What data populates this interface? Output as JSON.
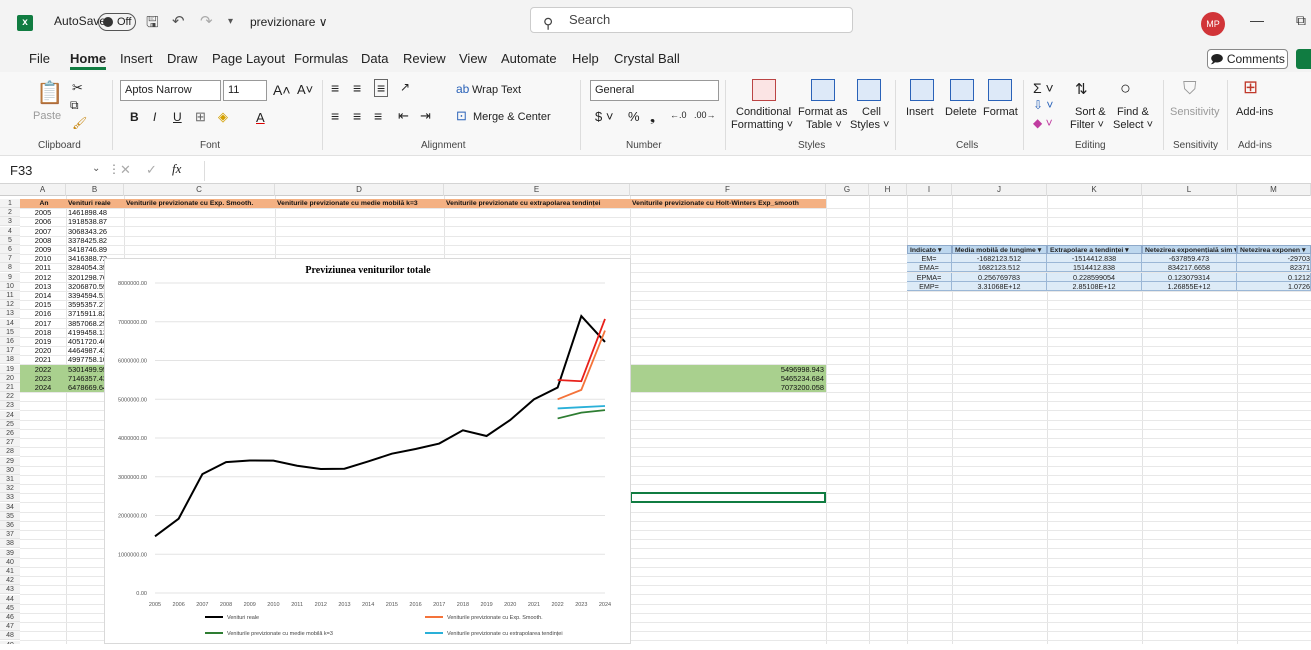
{
  "titlebar": {
    "autosave_label": "AutoSave",
    "autosave_state": "Off",
    "doc_name": "previzionare ∨",
    "search_placeholder": "Search",
    "avatar_initials": "MP",
    "minimize": "—",
    "restore": "⧉"
  },
  "menu": {
    "items": [
      "File",
      "Home",
      "Insert",
      "Draw",
      "Page Layout",
      "Formulas",
      "Data",
      "Review",
      "View",
      "Automate",
      "Help",
      "Crystal Ball"
    ],
    "active": "Home",
    "comments": "Comments"
  },
  "ribbon": {
    "paste": "Paste",
    "font_name": "Aptos Narrow",
    "font_size": "11",
    "wrap_text": "Wrap Text",
    "merge_center": "Merge & Center",
    "number_format": "General",
    "conditional": "Conditional",
    "formatting": "Formatting ˅",
    "format_as": "Format as",
    "table": "Table ˅",
    "cell": "Cell",
    "styles_btn": "Styles ˅",
    "insert": "Insert",
    "delete": "Delete",
    "format": "Format",
    "sort_filter": "Sort &",
    "filter": "Filter ˅",
    "find_select": "Find &",
    "select": "Select ˅",
    "sensitivity": "Sensitivity",
    "addins": "Add-ins",
    "groups": {
      "clipboard": "Clipboard",
      "font": "Font",
      "alignment": "Alignment",
      "number": "Number",
      "styles": "Styles",
      "cells": "Cells",
      "editing": "Editing",
      "sensitivity": "Sensitivity",
      "addins": "Add-ins"
    }
  },
  "formula_bar": {
    "name_box": "F33",
    "fx": "fx"
  },
  "columns": [
    "A",
    "B",
    "C",
    "D",
    "E",
    "F",
    "G",
    "H",
    "I",
    "J",
    "K",
    "L",
    "M"
  ],
  "headers": {
    "a": "An",
    "b": "Venituri reale",
    "c": "Veniturile previzionate cu Exp. Smooth.",
    "d": "Veniturile previzionate cu medie mobilă k=3",
    "e": "Veniturile previzionate cu extrapolarea tendinței",
    "f": "Veniturile previzionate cu Holt-Winters Exp_smooth"
  },
  "rows": [
    {
      "an": "2005",
      "real": "1461898.48"
    },
    {
      "an": "2006",
      "real": "1918538.87"
    },
    {
      "an": "2007",
      "real": "3068343.26"
    },
    {
      "an": "2008",
      "real": "3378425.82"
    },
    {
      "an": "2009",
      "real": "3418746.89"
    },
    {
      "an": "2010",
      "real": "3416388.72"
    },
    {
      "an": "2011",
      "real": "3284054.35"
    },
    {
      "an": "2012",
      "real": "3201298.76"
    },
    {
      "an": "2013",
      "real": "3206870.59"
    },
    {
      "an": "2014",
      "real": "3394594.51"
    },
    {
      "an": "2015",
      "real": "3595357.27"
    },
    {
      "an": "2016",
      "real": "3715911.82"
    },
    {
      "an": "2017",
      "real": "3857068.25"
    },
    {
      "an": "2018",
      "real": "4199458.13"
    },
    {
      "an": "2019",
      "real": "4051720.46"
    },
    {
      "an": "2020",
      "real": "4464987.42"
    },
    {
      "an": "2021",
      "real": "4997758.10"
    },
    {
      "an": "2022",
      "real": "5301499.95",
      "c": "4997758.097",
      "d": "4504821.995",
      "e": "4763286.525",
      "f": "5496998.943"
    },
    {
      "an": "2023",
      "real": "7146357.43",
      "c": "5241983.573",
      "d": "4655855.839",
      "e": "4794955.458",
      "f": "5465234.684"
    },
    {
      "an": "2024",
      "real": "6478669.64",
      "c": "6773206.924",
      "d": "4719478.643",
      "e": "4825046.516",
      "f": "7073200.058"
    }
  ],
  "indicators": {
    "headers": [
      "Indicato",
      "Media mobilă de lungime",
      "Extrapolare a tendinței",
      "Netezirea exponențială sim",
      "Netezirea exponen"
    ],
    "rows": [
      [
        "EM=",
        "-1682123.512",
        "-1514412.838",
        "-637859.473",
        "-29703"
      ],
      [
        "EMA=",
        "1682123.512",
        "1514412.838",
        "834217.6658",
        "82371"
      ],
      [
        "EPMA=",
        "0.256769783",
        "0.228599054",
        "0.123079314",
        "0.1212"
      ],
      [
        "EMP=",
        "3.31068E+12",
        "2.85108E+12",
        "1.26855E+12",
        "1.0726"
      ]
    ]
  },
  "chart_data": {
    "type": "line",
    "title": "Previziunea veniturilor totale",
    "x": [
      "2005",
      "2006",
      "2007",
      "2008",
      "2009",
      "2010",
      "2011",
      "2012",
      "2013",
      "2014",
      "2015",
      "2016",
      "2017",
      "2018",
      "2019",
      "2020",
      "2021",
      "2022",
      "2023",
      "2024"
    ],
    "ylim": [
      0,
      8000000
    ],
    "yticks": [
      "0.00",
      "1000000.00",
      "2000000.00",
      "3000000.00",
      "4000000.00",
      "5000000.00",
      "6000000.00",
      "7000000.00",
      "8000000.00"
    ],
    "grid": true,
    "legend_position": "bottom",
    "series": [
      {
        "name": "Venituri reale",
        "color": "#000000",
        "start": 0,
        "values": [
          1461898.48,
          1918538.87,
          3068343.26,
          3378425.82,
          3418746.89,
          3416388.72,
          3284054.35,
          3201298.76,
          3206870.59,
          3394594.51,
          3595357.27,
          3715911.82,
          3857068.25,
          4199458.13,
          4051720.46,
          4464987.42,
          4997758.1,
          5301499.95,
          7146357.43,
          6478669.64
        ]
      },
      {
        "name": "Veniturile previzionate cu Exp. Smooth.",
        "color": "#f4733a",
        "start": 17,
        "values": [
          4997758.097,
          5241983.573,
          6773206.924
        ]
      },
      {
        "name": "Veniturile previzionate cu medie mobilă k=3",
        "color": "#2e7d32",
        "start": 17,
        "values": [
          4504821.995,
          4655855.839,
          4719478.643
        ]
      },
      {
        "name": "Veniturile previzionate cu extrapolarea tendinței",
        "color": "#2ab0d8",
        "start": 17,
        "values": [
          4763286.525,
          4794955.458,
          4825046.516
        ]
      },
      {
        "name": "Veniturile previzionate cu Holt-Winters Exp_smooth",
        "color": "#e8201a",
        "start": 17,
        "values": [
          5496998.943,
          5465234.684,
          7073200.058
        ]
      }
    ]
  }
}
